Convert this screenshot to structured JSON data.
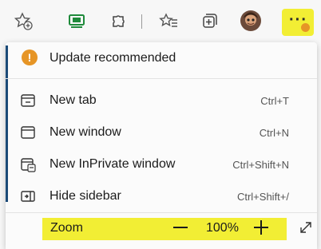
{
  "toolbar": {
    "icons": [
      "add-favorite-icon",
      "web-capture-icon",
      "extensions-icon",
      "favorites-icon",
      "collections-icon",
      "profile-avatar",
      "settings-and-more-icon"
    ],
    "more_label": "···"
  },
  "menu": {
    "update": {
      "label": "Update recommended",
      "icon": "update-badge-icon",
      "badge_glyph": "!"
    },
    "items": [
      {
        "label": "New tab",
        "shortcut": "Ctrl+T",
        "icon": "new-tab-icon"
      },
      {
        "label": "New window",
        "shortcut": "Ctrl+N",
        "icon": "new-window-icon"
      },
      {
        "label": "New InPrivate window",
        "shortcut": "Ctrl+Shift+N",
        "icon": "inprivate-window-icon"
      },
      {
        "label": "Hide sidebar",
        "shortcut": "Ctrl+Shift+/",
        "icon": "hide-sidebar-icon"
      }
    ],
    "zoom": {
      "label": "Zoom",
      "value": "100%",
      "minus_icon": "zoom-out-icon",
      "plus_icon": "zoom-in-icon",
      "fullscreen_icon": "fullscreen-icon"
    }
  },
  "colors": {
    "highlight": "#f2ee34",
    "badge": "#e69526",
    "accent_bar": "#1b4a78"
  }
}
